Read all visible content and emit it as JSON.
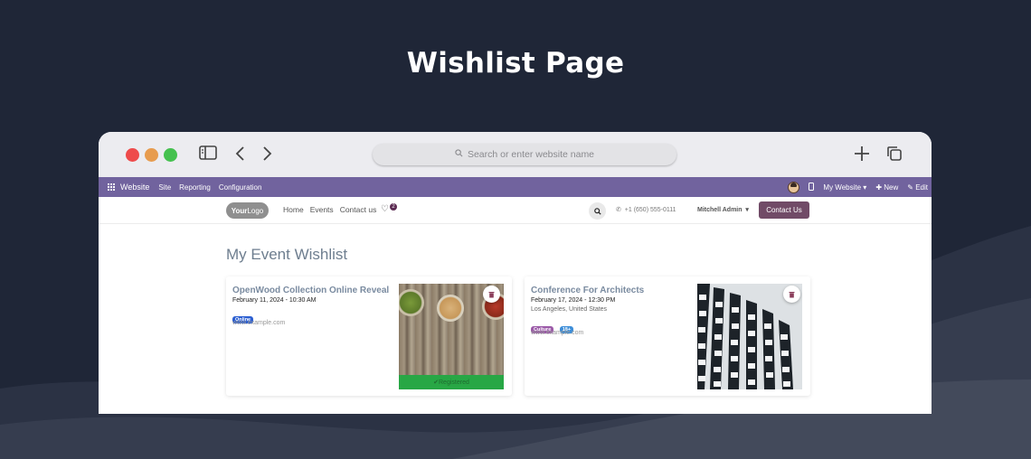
{
  "hero": {
    "title": "Wishlist Page"
  },
  "browser": {
    "search_placeholder": "Search or enter website name",
    "icons": [
      "sidebar-icon",
      "back-icon",
      "forward-icon",
      "search-icon",
      "plus-icon",
      "tabs-icon"
    ]
  },
  "topbar": {
    "brand": "Website",
    "menu": [
      "Site",
      "Reporting",
      "Configuration"
    ],
    "my_website": "My Website",
    "new_label": "New",
    "edit_label": "Edit",
    "color": "#71639e"
  },
  "navbar": {
    "logo_bold": "Your",
    "logo_rest": "Logo",
    "links": [
      "Home",
      "Events",
      "Contact us"
    ],
    "wishlist_count": "2",
    "phone": "+1 (650) 555-0111",
    "user": "Mitchell Admin",
    "contact_button": "Contact Us",
    "accent": "#714b67"
  },
  "main": {
    "heading": "My Event Wishlist",
    "cards": [
      {
        "title": "OpenWood Collection Online Reveal",
        "date": "February 11, 2024 - 10:30 AM",
        "location": "",
        "tags": [
          {
            "label": "Online",
            "color": "#2c5fd1"
          }
        ],
        "website": "www.example.com",
        "status": "Registered"
      },
      {
        "title": "Conference For Architects",
        "date": "February 17, 2024 - 12:30 PM",
        "location": "Los Angeles, United States",
        "tags": [
          {
            "label": "Culture",
            "color": "#9b5aa8"
          },
          {
            "label": "18+",
            "color": "#3e8ed8"
          }
        ],
        "website": "www.example.com",
        "status": ""
      }
    ]
  }
}
